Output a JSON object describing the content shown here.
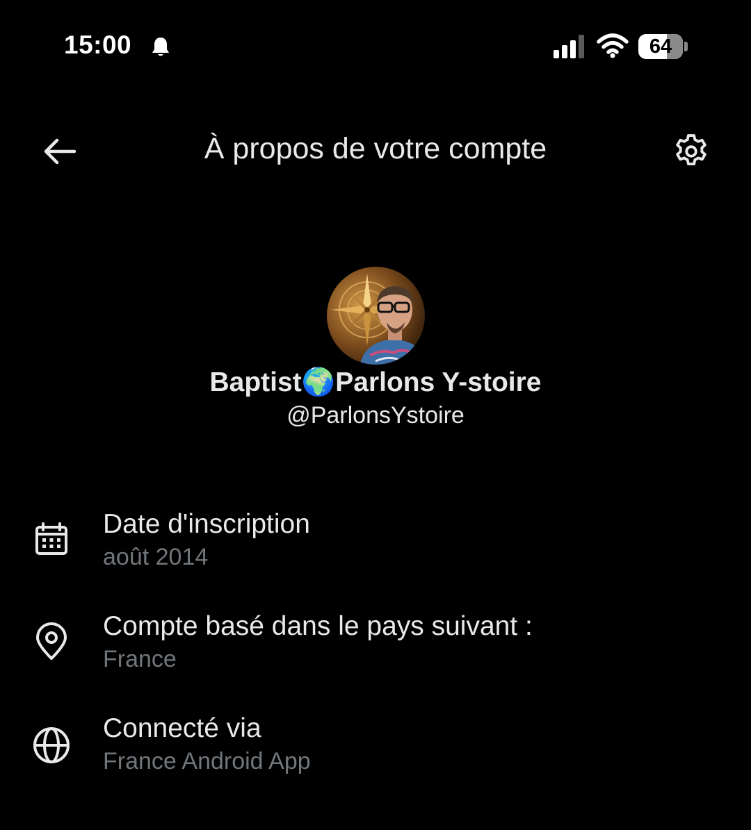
{
  "status_bar": {
    "time": "15:00",
    "battery": "64",
    "battery_level": 0.64,
    "icons": [
      "notification-bell-icon",
      "cellular-signal-icon",
      "wifi-icon",
      "battery-icon"
    ]
  },
  "header": {
    "title": "À propos de votre compte",
    "back_icon": "arrow-left-icon",
    "settings_icon": "gear-icon"
  },
  "profile": {
    "display_name": "Baptist🌍Parlons Y-stoire",
    "handle": "@ParlonsYstoire",
    "avatar": "profile-photo"
  },
  "info": [
    {
      "icon": "calendar-icon",
      "label": "Date d'inscription",
      "value": "août 2014"
    },
    {
      "icon": "location-pin-icon",
      "label": "Compte basé dans le pays suivant :",
      "value": "France"
    },
    {
      "icon": "globe-icon",
      "label": "Connecté via",
      "value": "France Android App"
    }
  ],
  "colors": {
    "background": "#000000",
    "primary_text": "#e7e9ea",
    "secondary_text": "#71767b"
  }
}
